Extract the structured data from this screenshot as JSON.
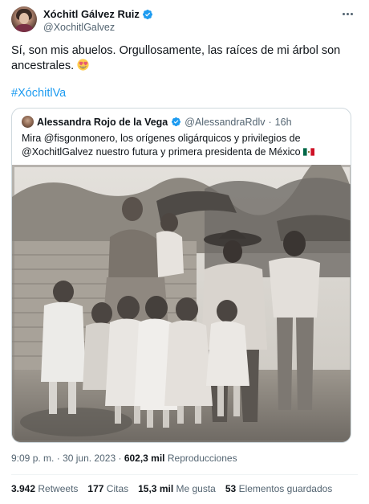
{
  "author": {
    "display_name": "Xóchitl Gálvez Ruiz",
    "handle": "@XochitlGalvez",
    "verified_color": "#1d9bf0"
  },
  "tweet": {
    "text": "Sí, son mis abuelos. Orgullosamente, las raíces de mi árbol son ancestrales.",
    "emoji": "heart-eyes-emoji",
    "hashtag": "#XóchitlVa"
  },
  "quoted": {
    "display_name": "Alessandra Rojo de la Vega",
    "handle": "@AlessandraRdlv",
    "separator": "·",
    "time": "16h",
    "text": "Mira @fisgonmonero, los orígenes oligárquicos y privilegios de @XochitlGalvez nuestro futura y primera presidenta de México",
    "flag": "mexico-flag-icon"
  },
  "meta": {
    "time": "9:09 p. m.",
    "sep1": "·",
    "date": "30 jun. 2023",
    "sep2": "·",
    "views_count": "602,3 mil",
    "views_label": "Reproducciones"
  },
  "stats": {
    "retweets_count": "3.942",
    "retweets_label": "Retweets",
    "quotes_count": "177",
    "quotes_label": "Citas",
    "likes_count": "15,3 mil",
    "likes_label": "Me gusta",
    "bookmarks_count": "53",
    "bookmarks_label": "Elementos guardados"
  },
  "colors": {
    "link": "#1d9bf0",
    "secondary_text": "#536471",
    "border": "#cfd9de"
  }
}
